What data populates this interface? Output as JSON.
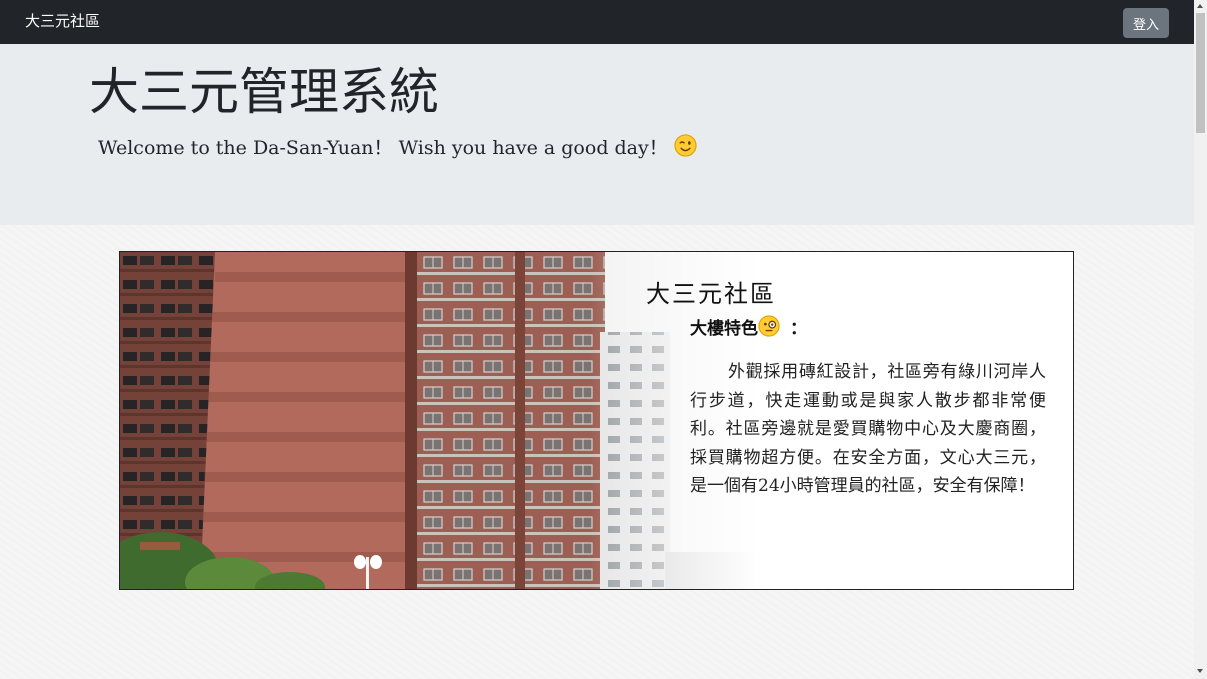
{
  "navbar": {
    "brand": "大三元社區",
    "login_label": "登入"
  },
  "jumbotron": {
    "title": "大三元管理系統",
    "subtitle": "Welcome to the Da-San-Yuan！ Wish you have a good day！"
  },
  "card": {
    "title": "大三元社區",
    "feature_label": "大樓特色",
    "feature_colon": "：",
    "description": "外觀採用磚紅設計，社區旁有綠川河岸人行步道，快走運動或是與家人散步都非常便利。社區旁邊就是愛買購物中心及大慶商圈，採買購物超方便。在安全方面，文心大三元，是一個有24小時管理員的社區，安全有保障！"
  },
  "icons": {
    "wink": "wink-emoji-icon",
    "thinking": "monocle-emoji-icon"
  },
  "colors": {
    "navbar_bg": "#212529",
    "jumbotron_bg": "#e9ecef",
    "button_bg": "#6c757d",
    "building_brick": "#b26a5d"
  }
}
